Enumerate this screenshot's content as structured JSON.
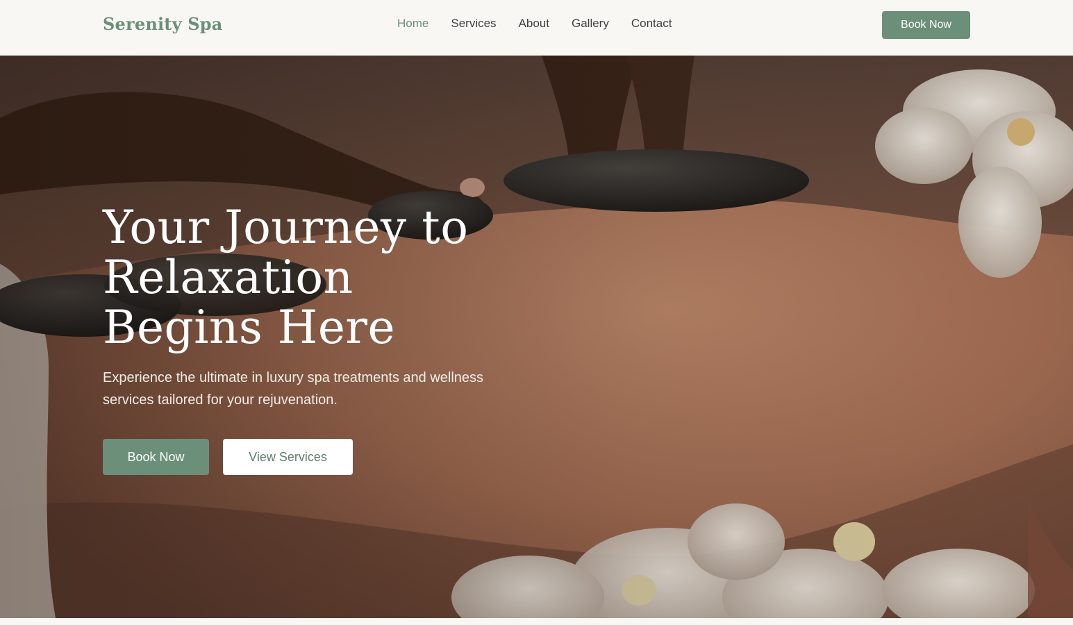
{
  "header": {
    "brand": "Serenity Spa",
    "nav": [
      {
        "label": "Home",
        "active": true
      },
      {
        "label": "Services",
        "active": false
      },
      {
        "label": "About",
        "active": false
      },
      {
        "label": "Gallery",
        "active": false
      },
      {
        "label": "Contact",
        "active": false
      }
    ],
    "book_label": "Book Now"
  },
  "hero": {
    "title_lines": [
      "Your Journey to",
      "Relaxation",
      "Begins Here"
    ],
    "subtitle": "Experience the ultimate in luxury spa treatments and wellness services tailored for your rejuvenation.",
    "primary_button": "Book Now",
    "secondary_button": "View Services",
    "image": "hot-stone-massage-photo"
  },
  "colors": {
    "accent": "#6b8f78",
    "background": "#f8f7f3",
    "nav_text": "#3f3f3f"
  }
}
